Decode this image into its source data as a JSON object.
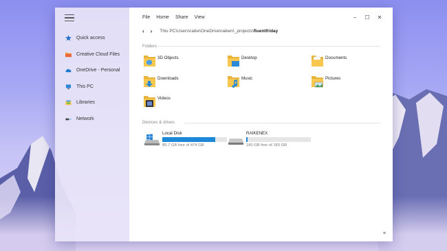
{
  "window": {
    "menu": [
      "File",
      "Home",
      "Share",
      "View"
    ],
    "controls": [
      "–",
      "☐",
      "✕"
    ]
  },
  "nav": {
    "back": "‹",
    "forward": "›",
    "path_prefix": "This PC\\Users\\raike\\OneDrive\\raiken\\_projects\\",
    "path_current": "fluentfriday"
  },
  "sidebar": {
    "items": [
      {
        "label": "Quick access",
        "icon": "pin-icon"
      },
      {
        "label": "Creative Cloud Files",
        "icon": "creative-cloud-icon"
      },
      {
        "label": "OneDrive - Personal",
        "icon": "cloud-icon"
      },
      {
        "label": "This PC",
        "icon": "pc-icon"
      },
      {
        "label": "Libraries",
        "icon": "libraries-icon"
      },
      {
        "label": "Network",
        "icon": "network-icon"
      }
    ]
  },
  "folders_section": {
    "title": "Folders",
    "items": [
      {
        "name": "3D Objects",
        "icon": "3d-objects-folder-icon"
      },
      {
        "name": "Desktop",
        "icon": "desktop-folder-icon"
      },
      {
        "name": "Documents",
        "icon": "documents-folder-icon"
      },
      {
        "name": "Downloads",
        "icon": "downloads-folder-icon"
      },
      {
        "name": "Music",
        "icon": "music-folder-icon"
      },
      {
        "name": "Pictures",
        "icon": "pictures-folder-icon"
      },
      {
        "name": "Videos",
        "icon": "videos-folder-icon"
      }
    ]
  },
  "devices_section": {
    "title": "Devices & drives",
    "drives": [
      {
        "name": "Local Disk",
        "free_text": "85.7 GB free of 474 GB",
        "used_fraction": 0.82
      },
      {
        "name": "RAIKENEX",
        "free_text": "180 GB free of 183 GB",
        "used_fraction": 0.02
      }
    ]
  },
  "view_toggle": "≡",
  "colors": {
    "accent": "#1e88d8",
    "folder": "#f7c750",
    "sidebar_bg": "#e8e4f8"
  }
}
